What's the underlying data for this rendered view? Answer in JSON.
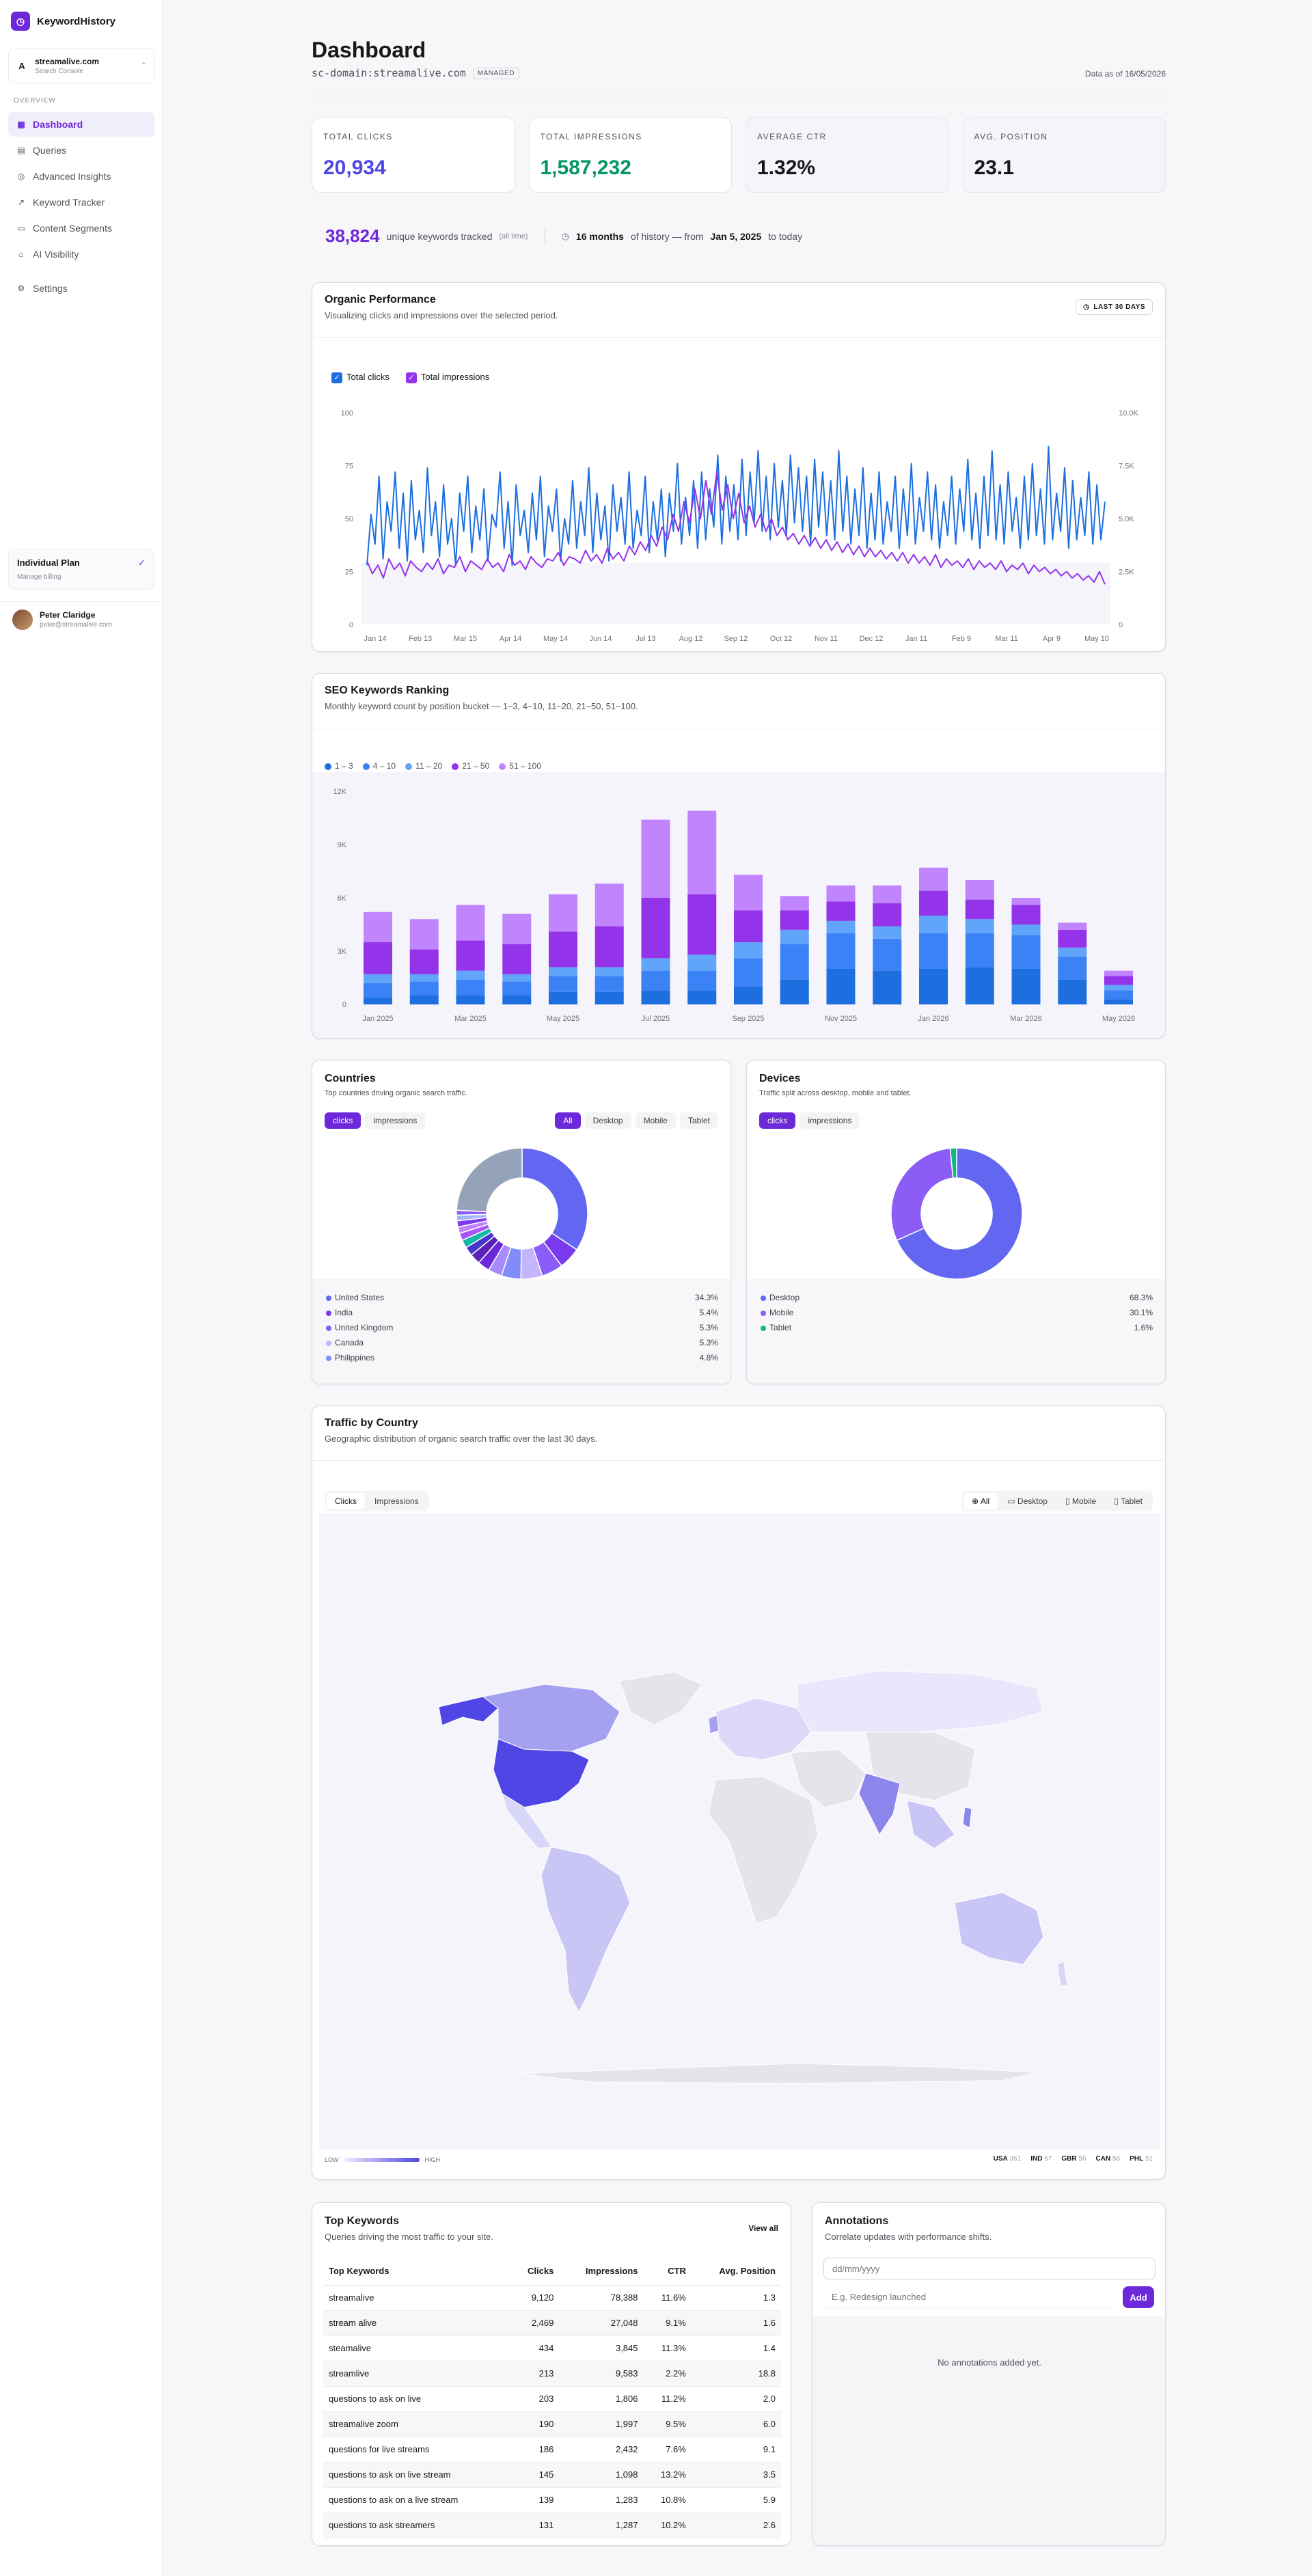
{
  "app": {
    "name": "KeywordHistory"
  },
  "site": {
    "name": "streamalive.com",
    "sub": "Search Console"
  },
  "nav": {
    "section": "Overview",
    "items": [
      {
        "label": "Dashboard",
        "icon": "grid-icon",
        "active": true
      },
      {
        "label": "Queries",
        "icon": "file-icon"
      },
      {
        "label": "Advanced Insights",
        "icon": "target-icon"
      },
      {
        "label": "Keyword Tracker",
        "icon": "trend-icon"
      },
      {
        "label": "Content Segments",
        "icon": "folder-icon"
      },
      {
        "label": "AI Visibility",
        "icon": "lock-icon"
      }
    ],
    "settings": "Settings"
  },
  "plan": {
    "title": "Individual Plan",
    "sub": "Manage billing"
  },
  "user": {
    "name": "Peter Claridge",
    "email": "peter@streamalive.com"
  },
  "header": {
    "title": "Dashboard",
    "domain": "sc-domain:streamalive.com",
    "badge": "MANAGED",
    "data_as_of": "Data as of 16/05/2026"
  },
  "kpis": [
    {
      "label": "Total Clicks",
      "value": "20,934",
      "color": "#4f46e5"
    },
    {
      "label": "Total Impressions",
      "value": "1,587,232",
      "color": "#059669"
    },
    {
      "label": "Average CTR",
      "value": "1.32%",
      "color": "#18181b"
    },
    {
      "label": "Avg. Position",
      "value": "23.1",
      "color": "#18181b"
    }
  ],
  "history": {
    "count": "38,824",
    "count_label": "unique keywords tracked",
    "count_note": "(all time)",
    "months": "16 months",
    "mid": "of history — from",
    "start": "Jan 5, 2025",
    "end": "to today"
  },
  "organic": {
    "title": "Organic Performance",
    "subtitle": "Visualizing clicks and impressions over the selected period.",
    "range_button": "LAST 30 DAYS",
    "legend": [
      {
        "label": "Total clicks",
        "color": "#1d6fe0"
      },
      {
        "label": "Total impressions",
        "color": "#9333ea"
      }
    ],
    "chart_data": {
      "type": "line",
      "x_ticks": [
        "Jan 14",
        "Feb 13",
        "Mar 15",
        "Apr 14",
        "May 14",
        "Jun 14",
        "Jul 13",
        "Aug 12",
        "Sep 12",
        "Oct 12",
        "Nov 11",
        "Dec 12",
        "Jan 11",
        "Feb 9",
        "Mar 11",
        "Apr 9",
        "May 10"
      ],
      "y_left_ticks": [
        "0",
        "25",
        "50",
        "75",
        "100"
      ],
      "y_right_ticks": [
        "0",
        "2.5K",
        "5.0K",
        "7.5K",
        "10.0K"
      ],
      "ylim_left": [
        0,
        100
      ],
      "ylim_right": [
        0,
        10000
      ],
      "series": [
        {
          "name": "Total clicks",
          "axis": "left",
          "values": [
            28,
            52,
            38,
            70,
            31,
            58,
            44,
            72,
            36,
            62,
            30,
            68,
            40,
            54,
            34,
            74,
            42,
            58,
            32,
            66,
            38,
            50,
            28,
            62,
            44,
            70,
            34,
            56,
            40,
            64,
            30,
            52,
            46,
            72,
            36,
            58,
            28,
            66,
            42,
            54,
            34,
            62,
            40,
            70,
            32,
            56,
            44,
            64,
            30,
            50,
            38,
            68,
            36,
            58,
            42,
            74,
            34,
            62,
            40,
            56,
            30,
            66,
            44,
            60,
            38,
            72,
            36,
            54,
            42,
            70,
            34,
            58,
            40,
            64,
            32,
            62,
            44,
            76,
            38,
            60,
            42,
            68,
            36,
            72,
            40,
            64,
            46,
            80,
            38,
            70,
            44,
            66,
            40,
            78,
            42,
            72,
            48,
            82,
            44,
            70,
            40,
            76,
            46,
            68,
            42,
            80,
            48,
            74,
            44,
            70,
            38,
            78,
            46,
            72,
            42,
            68,
            40,
            82,
            44,
            70,
            38,
            64,
            42,
            74,
            36,
            62,
            40,
            72,
            38,
            58,
            44,
            70,
            36,
            64,
            42,
            76,
            38,
            60,
            44,
            72,
            40,
            66,
            36,
            58,
            42,
            70,
            38,
            64,
            44,
            78,
            40,
            62,
            36,
            70,
            42,
            82,
            40,
            66,
            38,
            72,
            44,
            60,
            36,
            70,
            40,
            76,
            42,
            64,
            38,
            84,
            40,
            62,
            44,
            74,
            36,
            68,
            40,
            60,
            42,
            72,
            38,
            66,
            40,
            58
          ]
        },
        {
          "name": "Total impressions",
          "axis": "right",
          "values": [
            3000,
            2400,
            2800,
            2200,
            3100,
            2600,
            2900,
            2300,
            3000,
            2700,
            2500,
            2900,
            2600,
            3100,
            2400,
            2800,
            2700,
            3200,
            2500,
            3000,
            2800,
            2600,
            3100,
            2700,
            2900,
            2500,
            3300,
            2800,
            3000,
            2600,
            3200,
            2900,
            2700,
            3100,
            3000,
            3400,
            2800,
            3200,
            3100,
            2900,
            3500,
            3000,
            3300,
            2900,
            3600,
            3100,
            3400,
            3000,
            3700,
            3300,
            3900,
            3500,
            4200,
            3700,
            4600,
            4000,
            5200,
            4400,
            5800,
            4800,
            6400,
            5000,
            6800,
            5200,
            7200,
            5400,
            6600,
            5000,
            6200,
            4800,
            5600,
            4600,
            5200,
            4400,
            5000,
            4200,
            4600,
            4000,
            4300,
            3800,
            4200,
            3700,
            4100,
            3600,
            4000,
            3500,
            3900,
            3400,
            3800,
            3300,
            3700,
            3200,
            3600,
            3200,
            3500,
            3100,
            3400,
            3000,
            3400,
            2900,
            3300,
            2900,
            3200,
            2800,
            3300,
            2700,
            3100,
            2800,
            3000,
            2700,
            3100,
            2600,
            3000,
            2700,
            2900,
            2600,
            3000,
            2500,
            2800,
            2600,
            2900,
            2400,
            2800,
            2500,
            2700,
            2400,
            2600,
            2300,
            2500,
            2200,
            2400,
            2100,
            2300,
            2000,
            2500,
            1900
          ]
        }
      ]
    }
  },
  "seo": {
    "title": "SEO Keywords Ranking",
    "subtitle": "Monthly keyword count by position bucket — 1–3, 4–10, 11–20, 21–50, 51–100.",
    "chart_data": {
      "type": "bar",
      "stacked": true,
      "categories": [
        "Jan 2025",
        "Feb 2025",
        "Mar 2025",
        "Apr 2025",
        "May 2025",
        "Jun 2025",
        "Jul 2025",
        "Aug 2025",
        "Sep 2025",
        "Oct 2025",
        "Nov 2025",
        "Dec 2025",
        "Jan 2026",
        "Feb 2026",
        "Mar 2026",
        "Apr 2026",
        "May 2026"
      ],
      "x_tick_labels": [
        "Jan 2025",
        "",
        "Mar 2025",
        "",
        "May 2025",
        "",
        "Jul 2025",
        "",
        "Sep 2025",
        "",
        "Nov 2025",
        "",
        "Jan 2026",
        "",
        "Mar 2026",
        "",
        "May 2026"
      ],
      "y_ticks": [
        "0",
        "3K",
        "6K",
        "9K",
        "12K"
      ],
      "ylim": [
        0,
        12000
      ],
      "series": [
        {
          "name": "1 – 3",
          "color": "#1d6fe0",
          "values": [
            400,
            500,
            500,
            500,
            700,
            700,
            800,
            800,
            1000,
            1400,
            2000,
            1900,
            2000,
            2100,
            2000,
            1400,
            300
          ]
        },
        {
          "name": "4 – 10",
          "color": "#3b82f6",
          "values": [
            800,
            800,
            900,
            800,
            900,
            900,
            1100,
            1100,
            1600,
            2000,
            2000,
            1800,
            2000,
            1900,
            1900,
            1300,
            500
          ]
        },
        {
          "name": "11 – 20",
          "color": "#60a5fa",
          "values": [
            500,
            400,
            500,
            400,
            500,
            500,
            700,
            900,
            900,
            800,
            700,
            700,
            1000,
            800,
            600,
            500,
            300
          ]
        },
        {
          "name": "21 – 50",
          "color": "#9333ea",
          "values": [
            1800,
            1400,
            1700,
            1700,
            2000,
            2300,
            3400,
            3400,
            1800,
            1100,
            1100,
            1300,
            1400,
            1100,
            1100,
            1000,
            500
          ]
        },
        {
          "name": "51 – 100",
          "color": "#c084fc",
          "values": [
            1700,
            1700,
            2000,
            1700,
            2100,
            2400,
            4400,
            4700,
            2000,
            800,
            900,
            1000,
            1300,
            1100,
            400,
            400,
            300
          ]
        }
      ]
    }
  },
  "countries": {
    "title": "Countries",
    "subtitle": "Top countries driving organic search traffic.",
    "metric_tabs": [
      "clicks",
      "impressions"
    ],
    "device_tabs": [
      "All",
      "Desktop",
      "Mobile",
      "Tablet"
    ],
    "legend": [
      {
        "label": "United States",
        "value": "34.3%",
        "color": "#6366f1"
      },
      {
        "label": "India",
        "value": "5.4%",
        "color": "#7c3aed"
      },
      {
        "label": "United Kingdom",
        "value": "5.3%",
        "color": "#8b5cf6"
      },
      {
        "label": "Canada",
        "value": "5.3%",
        "color": "#c4b5fd"
      },
      {
        "label": "Philippines",
        "value": "4.8%",
        "color": "#818cf8"
      }
    ],
    "chart_data": {
      "type": "pie",
      "donut": true,
      "slices": [
        {
          "label": "United States",
          "value": 34.3,
          "color": "#6366f1"
        },
        {
          "label": "India",
          "value": 5.4,
          "color": "#7c3aed"
        },
        {
          "label": "United Kingdom",
          "value": 5.3,
          "color": "#8b5cf6"
        },
        {
          "label": "Canada",
          "value": 5.3,
          "color": "#c4b5fd"
        },
        {
          "label": "Philippines",
          "value": 4.8,
          "color": "#818cf8"
        },
        {
          "label": "",
          "value": 3.4,
          "color": "#a78bfa"
        },
        {
          "label": "",
          "value": 3.0,
          "color": "#6d28d9"
        },
        {
          "label": "",
          "value": 2.6,
          "color": "#5b21b6"
        },
        {
          "label": "",
          "value": 2.2,
          "color": "#4338ca"
        },
        {
          "label": "",
          "value": 2.0,
          "color": "#14b8a6"
        },
        {
          "label": "",
          "value": 1.8,
          "color": "#a855f7"
        },
        {
          "label": "",
          "value": 1.6,
          "color": "#c084fc"
        },
        {
          "label": "",
          "value": 1.5,
          "color": "#7c3aed"
        },
        {
          "label": "",
          "value": 1.4,
          "color": "#a5b4fc"
        },
        {
          "label": "",
          "value": 1.2,
          "color": "#8b5cf6"
        },
        {
          "label": "",
          "value": 24.2,
          "color": "#94a3b8"
        }
      ]
    }
  },
  "devices": {
    "title": "Devices",
    "subtitle": "Traffic split across desktop, mobile and tablet.",
    "metric_tabs": [
      "clicks",
      "impressions"
    ],
    "legend": [
      {
        "label": "Desktop",
        "value": "68.3%",
        "color": "#6366f1"
      },
      {
        "label": "Mobile",
        "value": "30.1%",
        "color": "#8b5cf6"
      },
      {
        "label": "Tablet",
        "value": "1.6%",
        "color": "#10b981"
      }
    ],
    "chart_data": {
      "type": "pie",
      "donut": true,
      "slices": [
        {
          "label": "Desktop",
          "value": 68.3,
          "color": "#6366f1"
        },
        {
          "label": "Mobile",
          "value": 30.1,
          "color": "#8b5cf6"
        },
        {
          "label": "Tablet",
          "value": 1.6,
          "color": "#10b981"
        }
      ]
    }
  },
  "traffic_map": {
    "title": "Traffic by Country",
    "subtitle": "Geographic distribution of organic search traffic over the last 30 days.",
    "metric_tabs": [
      "Clicks",
      "Impressions"
    ],
    "device_tabs": [
      "All",
      "Desktop",
      "Mobile",
      "Tablet"
    ],
    "scale_low": "LOW",
    "scale_high": "HIGH",
    "top_countries": [
      {
        "code": "USA",
        "value": "361"
      },
      {
        "code": "IND",
        "value": "67"
      },
      {
        "code": "GBR",
        "value": "56"
      },
      {
        "code": "CAN",
        "value": "56"
      },
      {
        "code": "PHL",
        "value": "51"
      }
    ]
  },
  "top_keywords": {
    "title": "Top Keywords",
    "subtitle": "Queries driving the most traffic to your site.",
    "view_all": "View all",
    "columns": [
      "Top Keywords",
      "Clicks",
      "Impressions",
      "CTR",
      "Avg. Position"
    ],
    "rows": [
      [
        "streamalive",
        "9,120",
        "78,388",
        "11.6%",
        "1.3"
      ],
      [
        "stream alive",
        "2,469",
        "27,048",
        "9.1%",
        "1.6"
      ],
      [
        "steamalive",
        "434",
        "3,845",
        "11.3%",
        "1.4"
      ],
      [
        "streamlive",
        "213",
        "9,583",
        "2.2%",
        "18.8"
      ],
      [
        "questions to ask on live",
        "203",
        "1,806",
        "11.2%",
        "2.0"
      ],
      [
        "streamalive zoom",
        "190",
        "1,997",
        "9.5%",
        "6.0"
      ],
      [
        "questions for live streams",
        "186",
        "2,432",
        "7.6%",
        "9.1"
      ],
      [
        "questions to ask on live stream",
        "145",
        "1,098",
        "13.2%",
        "3.5"
      ],
      [
        "questions to ask on a live stream",
        "139",
        "1,283",
        "10.8%",
        "5.9"
      ],
      [
        "questions to ask streamers",
        "131",
        "1,287",
        "10.2%",
        "2.6"
      ]
    ]
  },
  "annotations": {
    "title": "Annotations",
    "subtitle": "Correlate updates with performance shifts.",
    "date_placeholder": "dd/mm/yyyy",
    "note_placeholder": "E.g. Redesign launched",
    "add_label": "Add",
    "empty": "No annotations added yet."
  }
}
